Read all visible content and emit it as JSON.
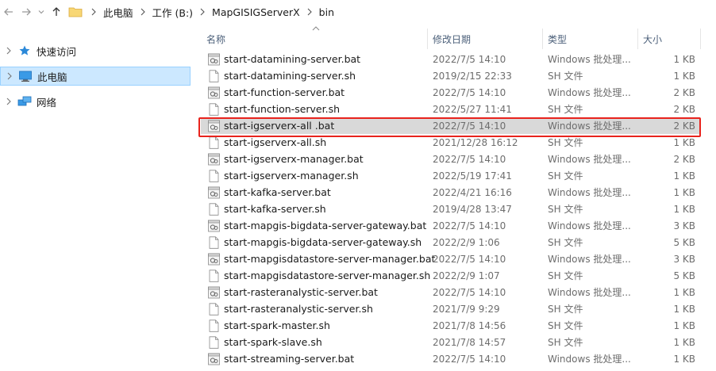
{
  "breadcrumb": {
    "items": [
      "此电脑",
      "工作 (B:)",
      "MapGISIGServerX",
      "bin"
    ]
  },
  "nav": {
    "items": [
      {
        "label": "快速访问",
        "icon": "star-icon"
      },
      {
        "label": "此电脑",
        "icon": "computer-icon"
      },
      {
        "label": "网络",
        "icon": "network-icon"
      }
    ]
  },
  "columns": {
    "name": "名称",
    "date": "修改日期",
    "type": "类型",
    "size": "大小"
  },
  "files": [
    {
      "name": "start-datamining-server.bat",
      "date": "2022/7/5 14:10",
      "type": "Windows 批处理...",
      "size": "1 KB",
      "kind": "bat"
    },
    {
      "name": "start-datamining-server.sh",
      "date": "2019/2/15 22:33",
      "type": "SH 文件",
      "size": "1 KB",
      "kind": "sh"
    },
    {
      "name": "start-function-server.bat",
      "date": "2022/7/5 14:10",
      "type": "Windows 批处理...",
      "size": "2 KB",
      "kind": "bat"
    },
    {
      "name": "start-function-server.sh",
      "date": "2022/5/27 11:41",
      "type": "SH 文件",
      "size": "2 KB",
      "kind": "sh"
    },
    {
      "name": "start-igserverx-all .bat",
      "date": "2022/7/5 14:10",
      "type": "Windows 批处理...",
      "size": "2 KB",
      "kind": "bat",
      "selected": true
    },
    {
      "name": "start-igserverx-all.sh",
      "date": "2021/12/28 16:12",
      "type": "SH 文件",
      "size": "1 KB",
      "kind": "sh"
    },
    {
      "name": "start-igserverx-manager.bat",
      "date": "2022/7/5 14:10",
      "type": "Windows 批处理...",
      "size": "2 KB",
      "kind": "bat"
    },
    {
      "name": "start-igserverx-manager.sh",
      "date": "2022/5/19 17:41",
      "type": "SH 文件",
      "size": "1 KB",
      "kind": "sh"
    },
    {
      "name": "start-kafka-server.bat",
      "date": "2022/4/21 16:16",
      "type": "Windows 批处理...",
      "size": "1 KB",
      "kind": "bat"
    },
    {
      "name": "start-kafka-server.sh",
      "date": "2019/4/28 13:47",
      "type": "SH 文件",
      "size": "1 KB",
      "kind": "sh"
    },
    {
      "name": "start-mapgis-bigdata-server-gateway.bat",
      "date": "2022/7/5 14:10",
      "type": "Windows 批处理...",
      "size": "3 KB",
      "kind": "bat"
    },
    {
      "name": "start-mapgis-bigdata-server-gateway.sh",
      "date": "2022/2/9 1:06",
      "type": "SH 文件",
      "size": "5 KB",
      "kind": "sh"
    },
    {
      "name": "start-mapgisdatastore-server-manager.bat",
      "date": "2022/7/5 14:10",
      "type": "Windows 批处理...",
      "size": "3 KB",
      "kind": "bat"
    },
    {
      "name": "start-mapgisdatastore-server-manager.sh",
      "date": "2022/2/9 1:07",
      "type": "SH 文件",
      "size": "5 KB",
      "kind": "sh"
    },
    {
      "name": "start-rasteranalystic-server.bat",
      "date": "2022/7/5 14:10",
      "type": "Windows 批处理...",
      "size": "1 KB",
      "kind": "bat"
    },
    {
      "name": "start-rasteranalystic-server.sh",
      "date": "2021/7/9 9:29",
      "type": "SH 文件",
      "size": "1 KB",
      "kind": "sh"
    },
    {
      "name": "start-spark-master.sh",
      "date": "2021/7/8 14:56",
      "type": "SH 文件",
      "size": "1 KB",
      "kind": "sh"
    },
    {
      "name": "start-spark-slave.sh",
      "date": "2021/7/8 14:57",
      "type": "SH 文件",
      "size": "1 KB",
      "kind": "sh"
    },
    {
      "name": "start-streaming-server.bat",
      "date": "2022/7/5 14:10",
      "type": "Windows 批处理...",
      "size": "1 KB",
      "kind": "bat"
    }
  ],
  "colors": {
    "selection_bg": "#d9d9d9",
    "highlight_border": "#e8231d",
    "nav_selected_bg": "#cce8ff",
    "header_text": "#4c607a"
  }
}
